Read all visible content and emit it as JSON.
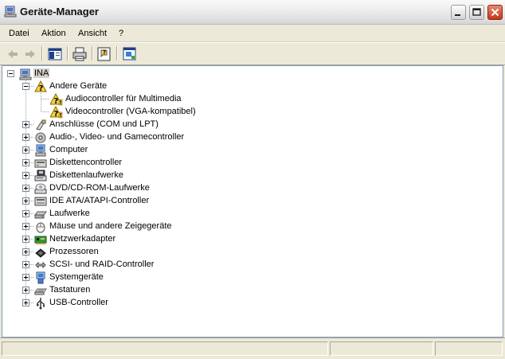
{
  "window": {
    "title": "Geräte-Manager"
  },
  "menu": [
    "Datei",
    "Aktion",
    "Ansicht",
    "?"
  ],
  "toolbar": [
    "back-icon",
    "forward-icon",
    "show-hide-tree-icon",
    "print-icon",
    "help-icon",
    "properties-icon"
  ],
  "tree": {
    "root": "INA",
    "categories": [
      {
        "label": "Andere Geräte",
        "icon": "unknown-device-icon",
        "expanded": true,
        "children": [
          {
            "label": "Audiocontroller für Multimedia",
            "icon": "warning-device-icon"
          },
          {
            "label": "Videocontroller (VGA-kompatibel)",
            "icon": "warning-device-icon"
          }
        ]
      },
      {
        "label": "Anschlüsse (COM und LPT)",
        "icon": "port-icon"
      },
      {
        "label": "Audio-, Video- und Gamecontroller",
        "icon": "speaker-icon"
      },
      {
        "label": "Computer",
        "icon": "computer-icon"
      },
      {
        "label": "Diskettencontroller",
        "icon": "floppy-controller-icon"
      },
      {
        "label": "Diskettenlaufwerke",
        "icon": "floppy-drive-icon"
      },
      {
        "label": "DVD/CD-ROM-Laufwerke",
        "icon": "cdrom-icon"
      },
      {
        "label": "IDE ATA/ATAPI-Controller",
        "icon": "ide-controller-icon"
      },
      {
        "label": "Laufwerke",
        "icon": "disk-drive-icon"
      },
      {
        "label": "Mäuse und andere Zeigegeräte",
        "icon": "mouse-icon"
      },
      {
        "label": "Netzwerkadapter",
        "icon": "network-adapter-icon"
      },
      {
        "label": "Prozessoren",
        "icon": "processor-icon"
      },
      {
        "label": "SCSI- und RAID-Controller",
        "icon": "scsi-icon"
      },
      {
        "label": "Systemgeräte",
        "icon": "system-device-icon"
      },
      {
        "label": "Tastaturen",
        "icon": "keyboard-icon"
      },
      {
        "label": "USB-Controller",
        "icon": "usb-icon"
      }
    ]
  }
}
